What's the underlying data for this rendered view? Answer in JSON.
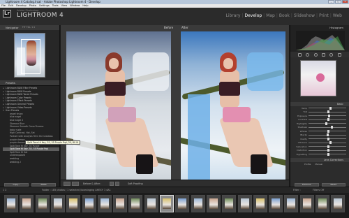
{
  "window": {
    "title": "Lightroom 4 Catalog.lrcat - Adobe Photoshop Lightroom 4 - Develop",
    "controls": [
      "_",
      "□",
      "×"
    ]
  },
  "menu": [
    "File",
    "Edit",
    "Develop",
    "Photo",
    "Settings",
    "Tools",
    "View",
    "Window",
    "Help"
  ],
  "identity": {
    "logo": "Lr",
    "subtitle": "Adobe Photoshop",
    "app_name": "LIGHTROOM 4",
    "modules": [
      "Library",
      "Develop",
      "Map",
      "Book",
      "Slideshow",
      "Print",
      "Web"
    ],
    "active_module": "Develop"
  },
  "left_panel": {
    "navigator_title": "Navigator",
    "navigator_zoom": "FIT   FILL   1:1",
    "presets_title": "Presets",
    "presets": [
      {
        "label": "Lightroom B&W Filter Presets",
        "level": 0,
        "selected": false
      },
      {
        "label": "Lightroom B&W Presets",
        "level": 0,
        "selected": false
      },
      {
        "label": "Lightroom B&W Toned Presets",
        "level": 0,
        "selected": false
      },
      {
        "label": "Lightroom Color Presets",
        "level": 0,
        "selected": false
      },
      {
        "label": "Lightroom Effect Presets",
        "level": 0,
        "selected": false
      },
      {
        "label": "Lightroom General Presets",
        "level": 0,
        "selected": false
      },
      {
        "label": "Lightroom Video Presets",
        "level": 0,
        "selected": false
      },
      {
        "label": "User Presets",
        "level": 0,
        "selected": false
      },
      {
        "label": "angel vision",
        "level": 1,
        "selected": false
      },
      {
        "label": "blue angel",
        "level": 1,
        "selected": false
      },
      {
        "label": "blue angel 2",
        "level": 1,
        "selected": false
      },
      {
        "label": "Glamour Blue",
        "level": 1,
        "selected": false
      },
      {
        "label": "Glamour Smooth Cross Process",
        "level": 1,
        "selected": false
      },
      {
        "label": "baby nude",
        "level": 1,
        "selected": false
      },
      {
        "label": "High Contrast, Hot, Set",
        "level": 1,
        "selected": false
      },
      {
        "label": "Portrait with Analysis fill in the shadows",
        "level": 1,
        "selected": false
      },
      {
        "label": "purple demon",
        "level": 1,
        "selected": false
      },
      {
        "label": "purple demon incubus",
        "level": 1,
        "selected": false
      },
      {
        "label": "Split Tone Hi Key, 50 Purple",
        "level": 1,
        "selected": false
      },
      {
        "label": "Split Tone Hi Key, 55, 55 Purple Prpl",
        "level": 1,
        "selected": true
      },
      {
        "label": "Split Tone Hi Sat",
        "level": 1,
        "selected": false
      },
      {
        "label": "underexposed",
        "level": 1,
        "selected": false
      },
      {
        "label": "wedding",
        "level": 1,
        "selected": false
      },
      {
        "label": "wedding 2",
        "level": 1,
        "selected": false
      }
    ],
    "tooltip": "Split Tone Hi Key, 55, 55 Purple Prpl, 25, 80 XI",
    "copy_label": "Copy...",
    "paste_label": "Paste"
  },
  "center": {
    "before_label": "Before",
    "after_label": "After",
    "toolbar_view": "Before & After :",
    "toolbar_proof": "Soft Proofing"
  },
  "right_panel": {
    "histogram_title": "Histogram",
    "basic_title": "Basic",
    "lens_title": "Lens Corrections",
    "lens_tabs": [
      "Profile",
      "Manual"
    ],
    "sliders": [
      {
        "label": "Temp",
        "value": 0.55
      },
      {
        "label": "Tint",
        "value": 0.5
      },
      {
        "label": "Exposure",
        "value": 0.52
      },
      {
        "label": "Contrast",
        "value": 0.5
      },
      {
        "label": "Highlights",
        "value": 0.45
      },
      {
        "label": "Shadows",
        "value": 0.6
      },
      {
        "label": "Whites",
        "value": 0.5
      },
      {
        "label": "Blacks",
        "value": 0.48
      }
    ],
    "sliders2": [
      {
        "label": "Clarity",
        "value": 0.5
      },
      {
        "label": "Vibrance",
        "value": 0.55
      },
      {
        "label": "Saturation",
        "value": 0.5
      },
      {
        "label": "Distortion",
        "value": 0.5
      },
      {
        "label": "Vignetting",
        "value": 0.5
      }
    ],
    "previous_label": "Previous",
    "reset_label": "Reset"
  },
  "filmstrip": {
    "folder_info": "Folder : 185 photos / 1 selected /lovesinging AHEXY 7.4A1",
    "pages": "1   2",
    "filter_label": "Filter :",
    "filter_value": "Filters Off",
    "thumb_count": 22,
    "active_thumb": 10
  }
}
